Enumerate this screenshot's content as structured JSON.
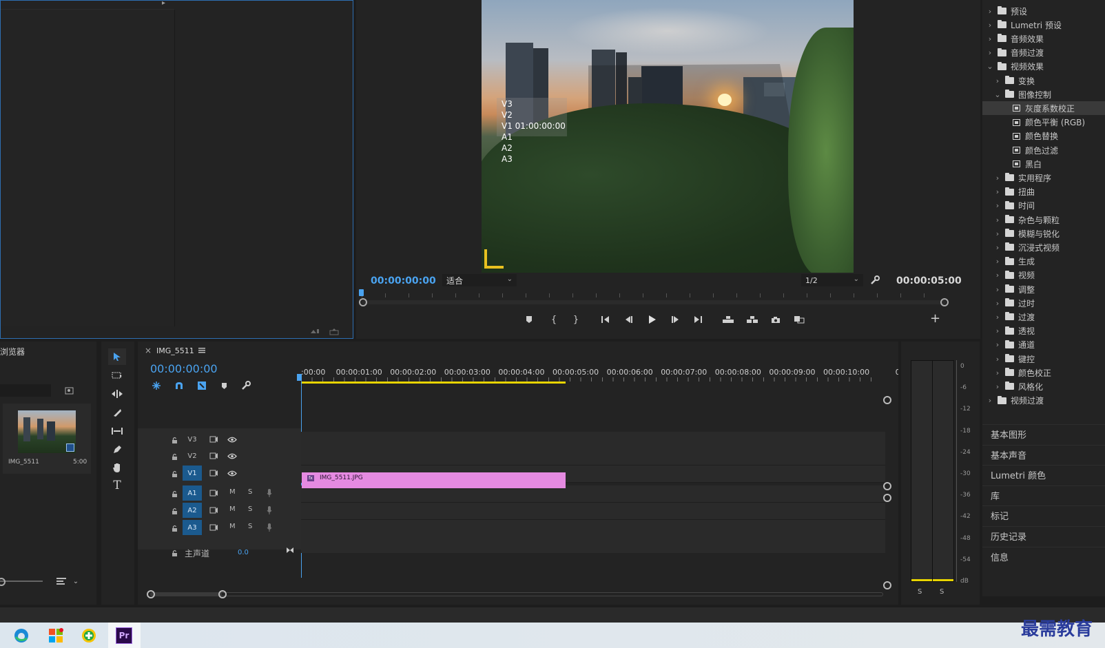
{
  "program_monitor": {
    "overlay_tracks": [
      "V3",
      "V2",
      "V1 01:00:00:00",
      "A1",
      "A2",
      "A3"
    ],
    "timecode_left": "00:00:00:00",
    "fit_label": "适合",
    "resolution_label": "1/2",
    "timecode_right": "00:00:05:00",
    "add_symbol": "+"
  },
  "project": {
    "title_fragment": "\t浏览器",
    "clip_name": "IMG_5511",
    "clip_duration": "5:00"
  },
  "timeline": {
    "tab_title": "IMG_5511",
    "close_symbol": "×",
    "timecode": "00:00:00:00",
    "ruler": [
      ":00:00",
      "00:00:01:00",
      "00:00:02:00",
      "00:00:03:00",
      "00:00:04:00",
      "00:00:05:00",
      "00:00:06:00",
      "00:00:07:00",
      "00:00:08:00",
      "00:00:09:00",
      "00:00:10:00",
      "0"
    ],
    "video_tracks": [
      "V3",
      "V2",
      "V1"
    ],
    "audio_tracks": [
      "A1",
      "A2",
      "A3"
    ],
    "mute_label": "M",
    "solo_label": "S",
    "master_label": "主声道",
    "master_value": "0.0",
    "clip_label": "IMG_5511.JPG",
    "clip_fraction_of_view": 0.384
  },
  "effects_tree": [
    {
      "level": 0,
      "type": "folder",
      "label": "预设",
      "expanded": false
    },
    {
      "level": 0,
      "type": "folder",
      "label": "Lumetri 预设",
      "expanded": false
    },
    {
      "level": 0,
      "type": "folder",
      "label": "音频效果",
      "expanded": false
    },
    {
      "level": 0,
      "type": "folder",
      "label": "音频过渡",
      "expanded": false
    },
    {
      "level": 0,
      "type": "folder",
      "label": "视频效果",
      "expanded": true
    },
    {
      "level": 1,
      "type": "folder",
      "label": "变换",
      "expanded": false
    },
    {
      "level": 1,
      "type": "folder",
      "label": "图像控制",
      "expanded": true
    },
    {
      "level": 2,
      "type": "effect",
      "label": "灰度系数校正",
      "selected": true
    },
    {
      "level": 2,
      "type": "effect",
      "label": "颜色平衡 (RGB)"
    },
    {
      "level": 2,
      "type": "effect",
      "label": "颜色替换"
    },
    {
      "level": 2,
      "type": "effect",
      "label": "颜色过滤"
    },
    {
      "level": 2,
      "type": "effect",
      "label": "黑白"
    },
    {
      "level": 1,
      "type": "folder",
      "label": "实用程序",
      "expanded": false
    },
    {
      "level": 1,
      "type": "folder",
      "label": "扭曲",
      "expanded": false
    },
    {
      "level": 1,
      "type": "folder",
      "label": "时间",
      "expanded": false
    },
    {
      "level": 1,
      "type": "folder",
      "label": "杂色与颗粒",
      "expanded": false
    },
    {
      "level": 1,
      "type": "folder",
      "label": "模糊与锐化",
      "expanded": false
    },
    {
      "level": 1,
      "type": "folder",
      "label": "沉浸式视频",
      "expanded": false
    },
    {
      "level": 1,
      "type": "folder",
      "label": "生成",
      "expanded": false
    },
    {
      "level": 1,
      "type": "folder",
      "label": "视频",
      "expanded": false
    },
    {
      "level": 1,
      "type": "folder",
      "label": "调整",
      "expanded": false
    },
    {
      "level": 1,
      "type": "folder",
      "label": "过时",
      "expanded": false
    },
    {
      "level": 1,
      "type": "folder",
      "label": "过渡",
      "expanded": false
    },
    {
      "level": 1,
      "type": "folder",
      "label": "透视",
      "expanded": false
    },
    {
      "level": 1,
      "type": "folder",
      "label": "通道",
      "expanded": false
    },
    {
      "level": 1,
      "type": "folder",
      "label": "键控",
      "expanded": false
    },
    {
      "level": 1,
      "type": "folder",
      "label": "颜色校正",
      "expanded": false
    },
    {
      "level": 1,
      "type": "folder",
      "label": "风格化",
      "expanded": false
    },
    {
      "level": 0,
      "type": "folder",
      "label": "视频过渡",
      "expanded": false
    }
  ],
  "side_panels": [
    "基本图形",
    "基本声音",
    "Lumetri 颜色",
    "库",
    "标记",
    "历史记录",
    "信息"
  ],
  "audio_meter": {
    "ticks": [
      "0",
      "-6",
      "-12",
      "-18",
      "-24",
      "-30",
      "-36",
      "-42",
      "-48",
      "-54",
      "dB"
    ],
    "solo_left": "S",
    "solo_right": "S"
  },
  "taskbar": {
    "app_label": "Pr",
    "watermark": "最需教育"
  },
  "colors": {
    "accent_blue": "#4aa3f0",
    "clip_pink": "#e58ae1",
    "work_area_yellow": "#e8d400",
    "track_active_blue": "#1b5a8e"
  }
}
